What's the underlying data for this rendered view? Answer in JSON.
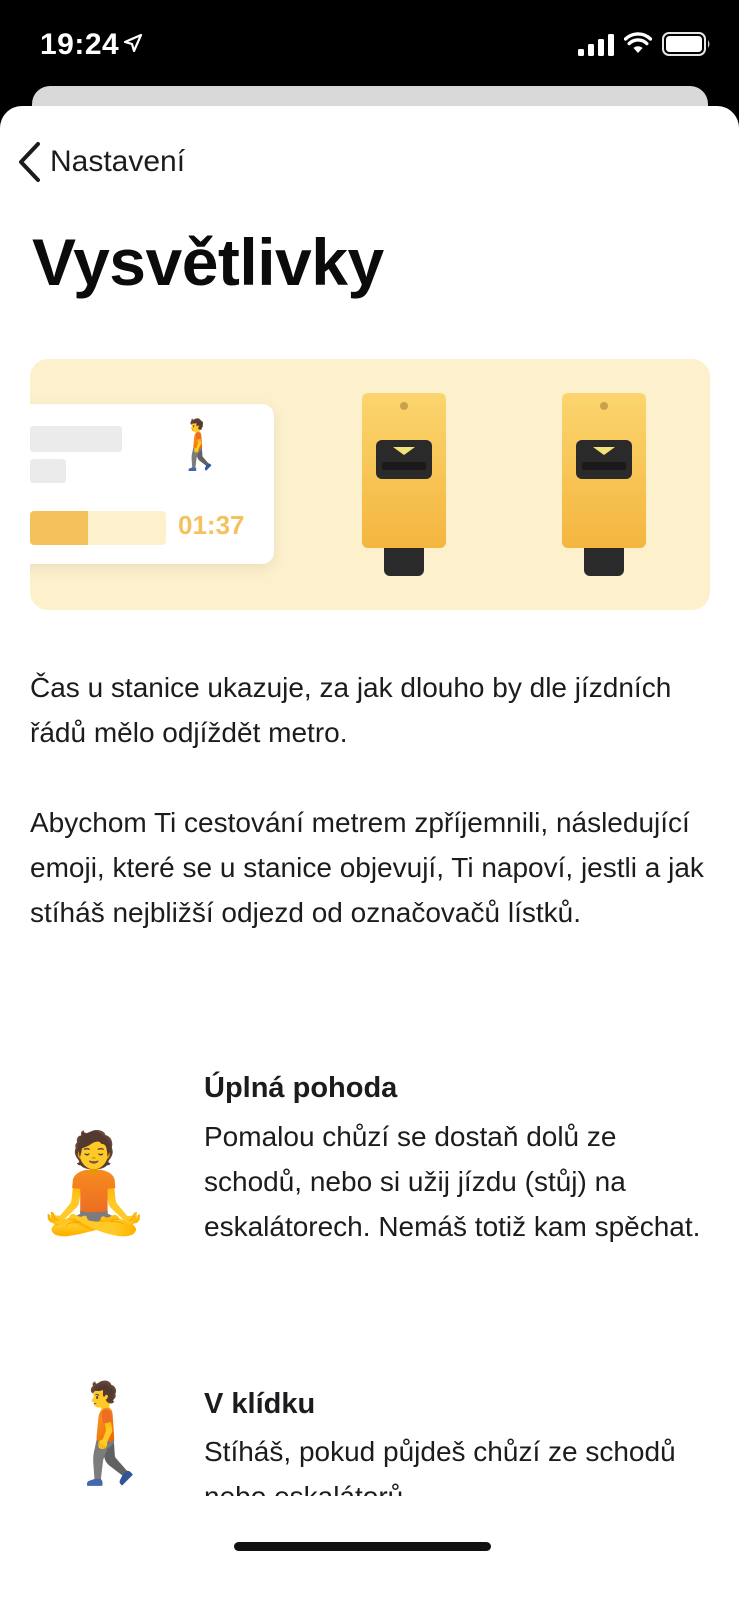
{
  "status_bar": {
    "time": "19:24"
  },
  "nav": {
    "back_label": "Nastavení"
  },
  "page": {
    "title": "Vysvětlivky"
  },
  "illustration": {
    "card_emoji": "🚶",
    "card_time": "01:37",
    "progress": 0.43,
    "accent_color": "#f5c15c",
    "background_color": "#fdf0cd"
  },
  "intro": [
    "Čas u stanice ukazuje, za jak dlouho by dle jízdních řádů mělo odjíždět metro.",
    "Abychom Ti cestování metrem zpříjemnili, následující emoji, které se u stanice objevují, Ti napoví, jestli a jak stíháš nejbližší odjezd od označovačů lístků."
  ],
  "legend": [
    {
      "emoji": "🧘",
      "title": "Úplná pohoda",
      "description": "Pomalou chůzí se dostaň dolů ze schodů, nebo si užij jízdu (stůj) na eskalátorech. Nemáš totiž kam spěchat."
    },
    {
      "emoji": "🚶",
      "title": "V klídku",
      "description": "Stíháš, pokud půjdeš chůzí ze schodů nebo eskalátorů"
    }
  ]
}
